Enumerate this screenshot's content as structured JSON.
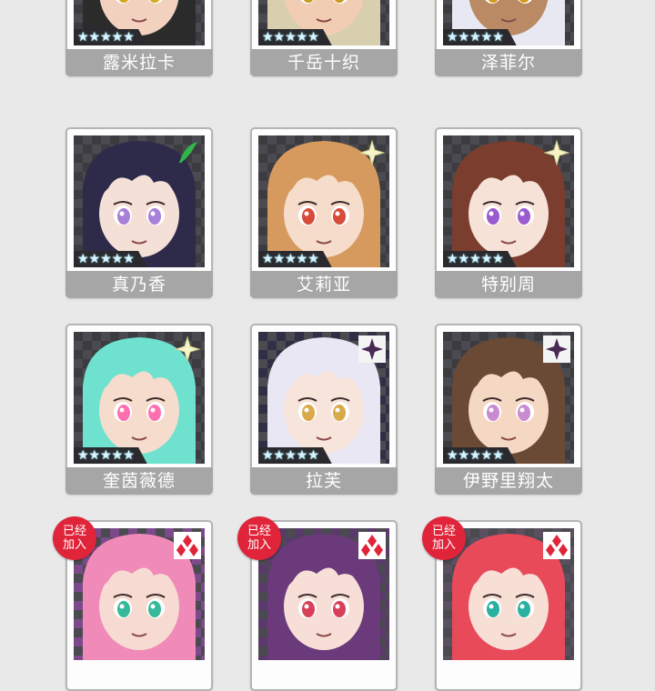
{
  "characters": [
    {
      "name": "露米拉卡",
      "stars": "★★★★★",
      "element": "",
      "hair": "#2b2b2b",
      "skin": "#f2d2bf",
      "eyes": "#d7a820",
      "bg": "#3b3b40",
      "joined": false
    },
    {
      "name": "千岳十织",
      "stars": "★★★★★",
      "element": "",
      "hair": "#d8cfae",
      "skin": "#f1cdb4",
      "eyes": "#c99a22",
      "bg": "#3b3b40",
      "joined": false
    },
    {
      "name": "泽菲尔",
      "stars": "★★★★★",
      "element": "",
      "hair": "#e8e8f2",
      "skin": "#b98a63",
      "eyes": "#d49a1a",
      "bg": "#3b3b40",
      "joined": false
    },
    {
      "name": "真乃香",
      "stars": "★★★★★",
      "element": "leaf-green",
      "hair": "#2e2a4a",
      "skin": "#f5e0d8",
      "eyes": "#a980d8",
      "bg": "#3b3b40",
      "joined": false
    },
    {
      "name": "艾莉亚",
      "stars": "★★★★★",
      "element": "sparkle-light",
      "hair": "#d79a5e",
      "skin": "#f6dccb",
      "eyes": "#d84a3a",
      "bg": "#3b3b40",
      "joined": false
    },
    {
      "name": "特别周",
      "stars": "★★★★★",
      "element": "sparkle-light",
      "hair": "#7a3d2e",
      "skin": "#f7e2d8",
      "eyes": "#9a5ad0",
      "bg": "#3b3b40",
      "joined": false
    },
    {
      "name": "奎茵薇德",
      "stars": "★★★★★",
      "element": "sparkle-light",
      "hair": "#6fe1cf",
      "skin": "#f5dccd",
      "eyes": "#ff6fb0",
      "bg": "#3b3b40",
      "joined": false
    },
    {
      "name": "拉芙",
      "stars": "★★★★★",
      "element": "star-dark",
      "hair": "#e9e7f3",
      "skin": "#f7e4da",
      "eyes": "#d9a94a",
      "bg": "#2f2f45",
      "joined": false
    },
    {
      "name": "伊野里翔太",
      "stars": "★★★★★",
      "element": "star-dark",
      "hair": "#6b4a35",
      "skin": "#f5d8c3",
      "eyes": "#c98ad0",
      "bg": "#3b3b40",
      "joined": false
    },
    {
      "name": "",
      "stars": "",
      "element": "diamond-red",
      "hair": "#f08ab8",
      "skin": "#f7dbd2",
      "eyes": "#36b89a",
      "bg": "#7c4a8a",
      "joined": true
    },
    {
      "name": "",
      "stars": "",
      "element": "diamond-red",
      "hair": "#6a3a7a",
      "skin": "#f7dfd8",
      "eyes": "#d8405a",
      "bg": "#5a3a6a",
      "joined": true
    },
    {
      "name": "",
      "stars": "",
      "element": "diamond-red",
      "hair": "#e84a5a",
      "skin": "#f7dfd6",
      "eyes": "#2ab0a0",
      "bg": "#5a5060",
      "joined": true
    }
  ],
  "joined_label": "已经\n加入"
}
